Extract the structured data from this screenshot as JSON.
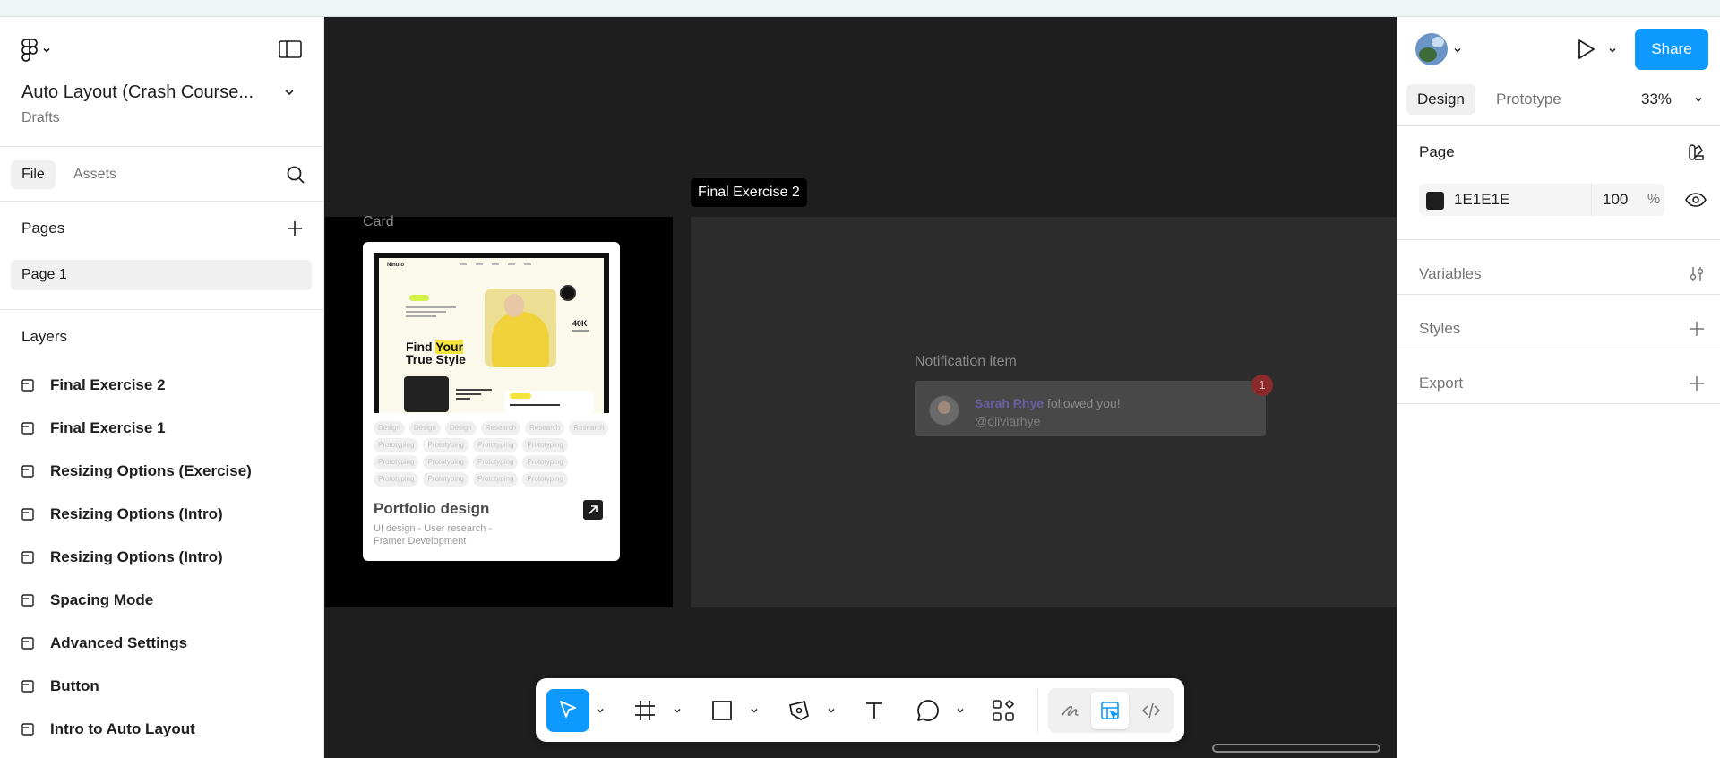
{
  "left_panel": {
    "file_title": "Auto Layout (Crash Course...",
    "file_location": "Drafts",
    "tabs": {
      "file": "File",
      "assets": "Assets"
    },
    "pages_heading": "Pages",
    "pages": [
      "Page 1"
    ],
    "layers_heading": "Layers",
    "layers": [
      "Final Exercise 2",
      "Final Exercise 1",
      "Resizing Options (Exercise)",
      "Resizing Options (Intro)",
      "Resizing Options (Intro)",
      "Spacing Mode",
      "Advanced Settings",
      "Button",
      "Intro to Auto Layout"
    ]
  },
  "canvas": {
    "card_frame_label": "Card",
    "card": {
      "site_logo": "Ninuto",
      "hero_line1_a": "Find ",
      "hero_line1_b": "Your",
      "hero_line2": "True Style",
      "stat_value": "40K",
      "tags": [
        "Design",
        "Design",
        "Design",
        "Research",
        "Research",
        "Research",
        "Prototyping",
        "Prototyping",
        "Prototyping",
        "Prototyping",
        "Prototyping",
        "Prototyping",
        "Prototyping",
        "Prototyping",
        "Prototyping",
        "Prototyping",
        "Prototyping",
        "Prototyping"
      ],
      "title": "Portfolio design",
      "subtitle": "UI design - User research - Framer Development"
    },
    "selected_frame_label": "Final Exercise 2",
    "notification_label": "Notification item",
    "notification": {
      "name": "Sarah Rhye",
      "action": " followed you!",
      "handle": "@oliviarhye",
      "badge_count": "1"
    }
  },
  "toolbar": {
    "tools": [
      "move-tool",
      "frame-tool",
      "shape-tool",
      "pen-tool",
      "text-tool",
      "comment-tool",
      "actions-tool"
    ],
    "modes": [
      "draw-mode",
      "design-mode",
      "dev-mode"
    ],
    "active_tool": "move-tool",
    "active_mode": "design-mode"
  },
  "right_panel": {
    "share_label": "Share",
    "tabs": {
      "design": "Design",
      "prototype": "Prototype"
    },
    "zoom": "33%",
    "page_section": "Page",
    "page_color_hex": "1E1E1E",
    "page_opacity": "100",
    "opacity_unit": "%",
    "variables": "Variables",
    "styles": "Styles",
    "export": "Export"
  },
  "help_label": "?",
  "colors": {
    "accent": "#0d99ff",
    "canvas": "#1e1e1e",
    "notification_badge": "#8b2a2a"
  }
}
